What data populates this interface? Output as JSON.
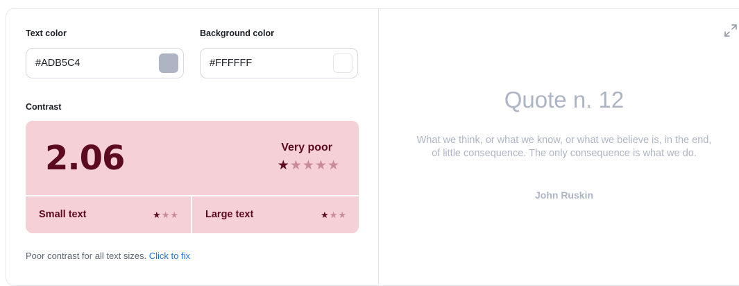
{
  "colors": {
    "text": "#ADB5C4",
    "background": "#FFFFFF",
    "card_bg": "#F5D0D6",
    "card_fg": "#5C0A1F",
    "star_dim": "#C98A9A",
    "divider": "#FFFFFF"
  },
  "text_color": {
    "label": "Text color",
    "value": "#ADB5C4"
  },
  "background_color": {
    "label": "Background color",
    "value": "#FFFFFF"
  },
  "contrast": {
    "label": "Contrast",
    "ratio": "2.06",
    "rating": "Very poor",
    "rating_stars": 1,
    "max_stars": 5,
    "small_text": {
      "label": "Small text",
      "stars": 1,
      "max_stars": 3
    },
    "large_text": {
      "label": "Large text",
      "stars": 1,
      "max_stars": 3
    }
  },
  "footer": {
    "message": "Poor contrast for all text sizes.",
    "link": "Click to fix"
  },
  "preview": {
    "expand_icon": "expand-icon",
    "title": "Quote n. 12",
    "quote": "What we think, or what we know, or what we believe is, in the end, of little consequence. The only consequence is what we do.",
    "author": "John Ruskin"
  }
}
